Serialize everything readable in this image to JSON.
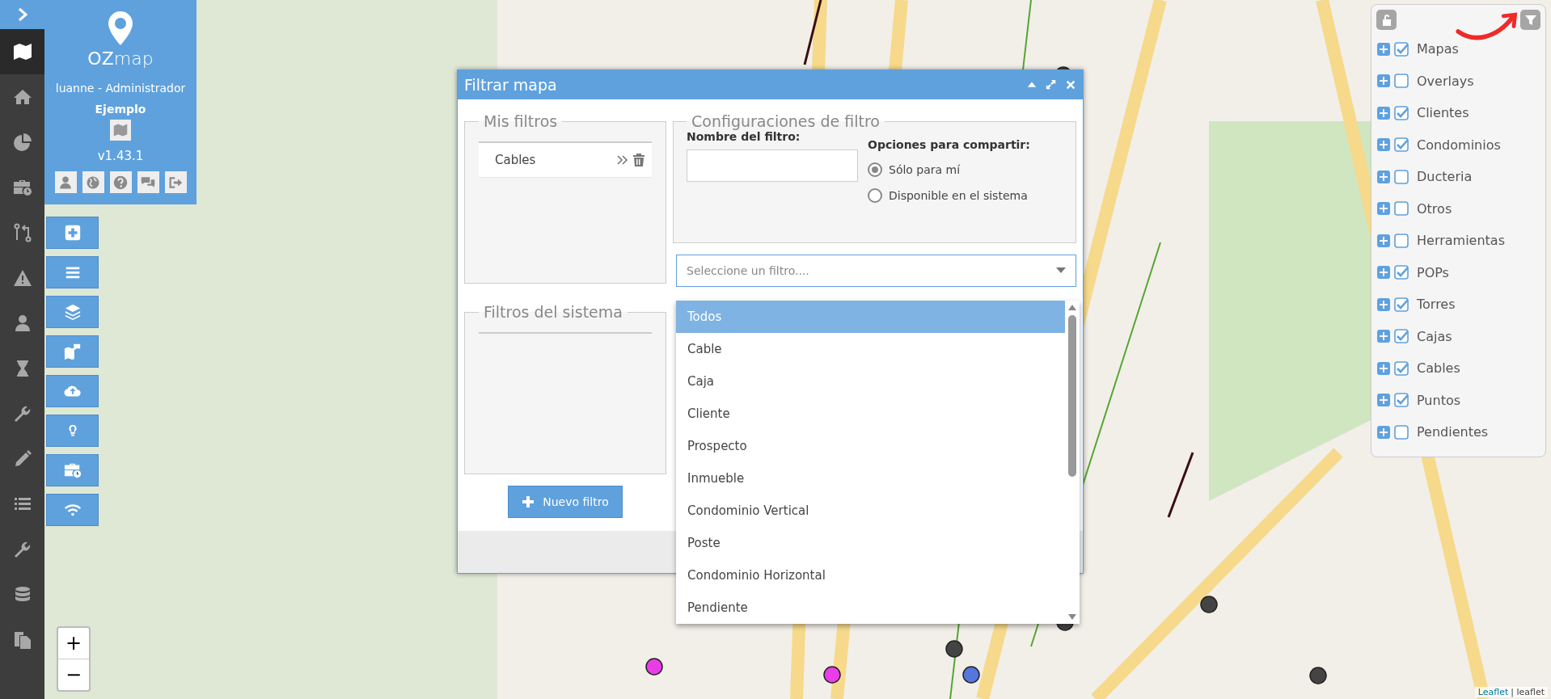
{
  "sidebar": {
    "items": [
      {
        "selected": true
      },
      {
        "selected": false
      },
      {
        "selected": false
      },
      {
        "selected": false
      },
      {
        "selected": false
      },
      {
        "selected": false
      },
      {
        "selected": false
      },
      {
        "selected": false
      },
      {
        "selected": false
      },
      {
        "selected": false
      },
      {
        "selected": false
      },
      {
        "selected": false
      },
      {
        "selected": false
      },
      {
        "selected": false
      }
    ]
  },
  "user_panel": {
    "logo": "**OZ**map",
    "user": "luanne - Administrador",
    "project": "Ejemplo",
    "version": "v1.43.1"
  },
  "dialog": {
    "title": "Filtrar mapa",
    "my_filters": {
      "title": "Mis filtros",
      "items": [
        {
          "label": "Cables"
        }
      ]
    },
    "system_filters": {
      "title": "Filtros del sistema"
    },
    "new_filter_button": "Nuevo filtro",
    "config": {
      "title": "Configuraciones de filtro",
      "name_label": "Nombre del filtro:",
      "share_label": "Opciones para compartir:",
      "share_options": [
        {
          "label": "Sólo para mí",
          "selected": true
        },
        {
          "label": "Disponible en el sistema",
          "selected": false
        }
      ]
    },
    "select": {
      "placeholder": "Seleccione un filtro....",
      "options": [
        {
          "label": "Todos",
          "selected": true
        },
        {
          "label": "Cable",
          "selected": false
        },
        {
          "label": "Caja",
          "selected": false
        },
        {
          "label": "Cliente",
          "selected": false
        },
        {
          "label": "Prospecto",
          "selected": false
        },
        {
          "label": "Inmueble",
          "selected": false
        },
        {
          "label": "Condominio Vertical",
          "selected": false
        },
        {
          "label": "Poste",
          "selected": false
        },
        {
          "label": "Condominio Horizontal",
          "selected": false
        },
        {
          "label": "Pendiente",
          "selected": false
        }
      ]
    }
  },
  "layers": {
    "items": [
      {
        "label": "Mapas",
        "checked": true
      },
      {
        "label": "Overlays",
        "checked": false
      },
      {
        "label": "Clientes",
        "checked": true
      },
      {
        "label": "Condominios",
        "checked": true
      },
      {
        "label": "Ducteria",
        "checked": false
      },
      {
        "label": "Otros",
        "checked": false
      },
      {
        "label": "Herramientas",
        "checked": false
      },
      {
        "label": "POPs",
        "checked": true
      },
      {
        "label": "Torres",
        "checked": true
      },
      {
        "label": "Cajas",
        "checked": true
      },
      {
        "label": "Cables",
        "checked": true
      },
      {
        "label": "Puntos",
        "checked": true
      },
      {
        "label": "Pendientes",
        "checked": false
      }
    ]
  },
  "zoom": {
    "in": "+",
    "out": "−"
  },
  "attribution": {
    "link": "Leaflet",
    "text": "| leaflet"
  }
}
